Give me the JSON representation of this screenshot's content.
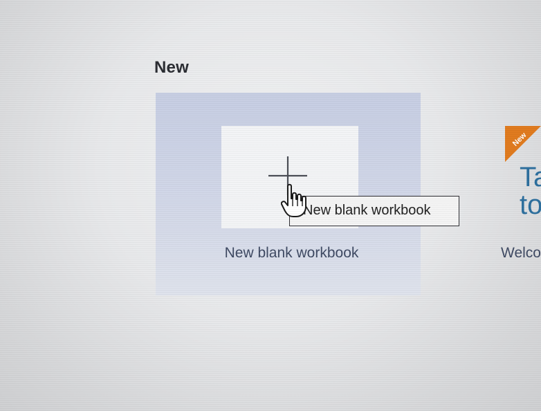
{
  "new_section": {
    "title": "New"
  },
  "blank_workbook": {
    "label": "New blank workbook",
    "tooltip": "New blank workbook"
  },
  "welcome_tile": {
    "badge": "New",
    "heading": "Ta\nto",
    "label": "Welco"
  },
  "colors": {
    "tile_background": "#cbd1e4",
    "thumbnail": "#f3f4f6",
    "badge": "#e07b1f",
    "heading_blue": "#2d6f9e",
    "label_text": "#3f4a63"
  },
  "icons": [
    "plus-icon",
    "hand-pointer-cursor-icon",
    "new-badge-icon"
  ]
}
